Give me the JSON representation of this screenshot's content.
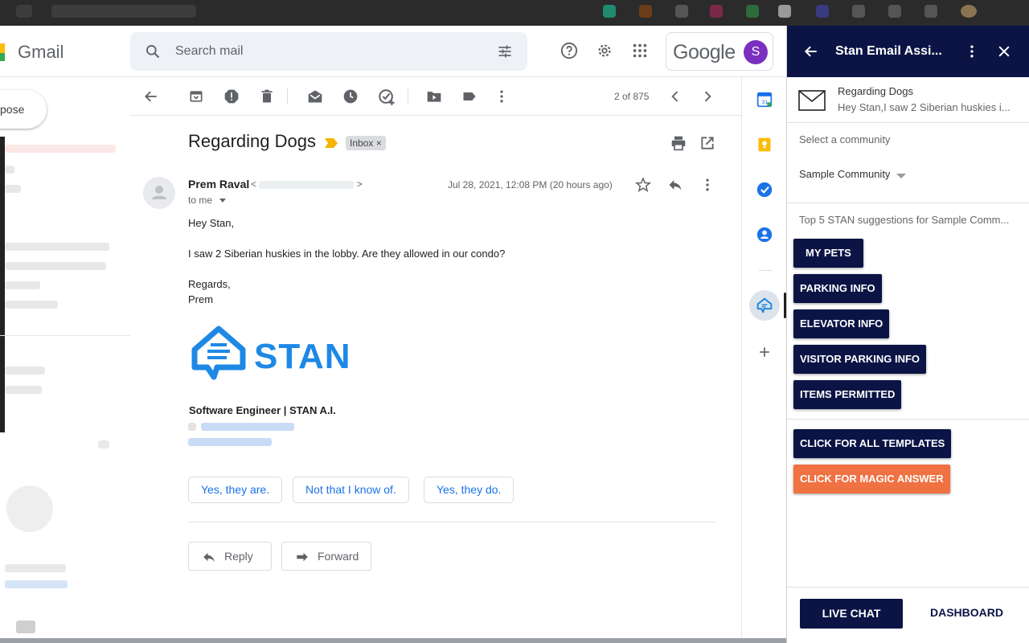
{
  "app": {
    "name": "Gmail",
    "search_placeholder": "Search mail",
    "account_brand": "Google",
    "account_initial": "S"
  },
  "left_nav": {
    "compose_label": "pose"
  },
  "toolbar": {
    "page_count": "2 of 875"
  },
  "message": {
    "subject": "Regarding Dogs",
    "label": "Inbox",
    "label_remove": "×",
    "sender_name": "Prem Raval",
    "sender_open": "<",
    "sender_close": ">",
    "to_line": "to me",
    "date": "Jul 28, 2021, 12:08 PM (20 hours ago)",
    "body": {
      "greeting": "Hey Stan,",
      "line1": "I saw 2 Siberian huskies in the lobby. Are they allowed in our condo?",
      "closing": "Regards,",
      "name": "Prem"
    },
    "signature_logo_text": "STAN",
    "signature_title": "Software Engineer | STAN A.I.",
    "smart_replies": [
      "Yes, they are.",
      "Not that I know of.",
      "Yes, they do."
    ],
    "reply_label": "Reply",
    "forward_label": "Forward"
  },
  "panel": {
    "title": "Stan Email Assi...",
    "email_subject": "Regarding Dogs",
    "email_snippet": "Hey Stan,I saw 2 Siberian huskies i...",
    "community_label": "Select a community",
    "community_value": "Sample Community",
    "suggestions_label": "Top 5 STAN suggestions for Sample Comm...",
    "suggestions": [
      "MY PETS",
      "PARKING INFO",
      "ELEVATOR INFO",
      "VISITOR PARKING INFO",
      "ITEMS PERMITTED"
    ],
    "all_templates_label": "CLICK FOR ALL TEMPLATES",
    "magic_answer_label": "CLICK FOR MAGIC ANSWER",
    "live_chat_label": "LIVE CHAT",
    "dashboard_label": "DASHBOARD"
  },
  "colors": {
    "panel_navy": "#0b1445",
    "magic_orange": "#f07142",
    "stan_blue": "#1e88e5",
    "gmail_blue": "#1a73e8"
  },
  "icons": [
    "search-icon",
    "tune-icon",
    "help-icon",
    "gear-icon",
    "apps-icon",
    "back-arrow-icon",
    "archive-icon",
    "report-spam-icon",
    "delete-icon",
    "mark-unread-icon",
    "snooze-icon",
    "add-task-icon",
    "move-to-icon",
    "label-icon",
    "more-vert-icon",
    "chevron-left-icon",
    "chevron-right-icon",
    "print-icon",
    "open-new-window-icon",
    "star-icon",
    "reply-icon",
    "forward-icon",
    "calendar-icon",
    "keep-icon",
    "tasks-icon",
    "contacts-icon",
    "stan-addon-icon",
    "plus-icon",
    "close-icon",
    "envelope-icon"
  ]
}
